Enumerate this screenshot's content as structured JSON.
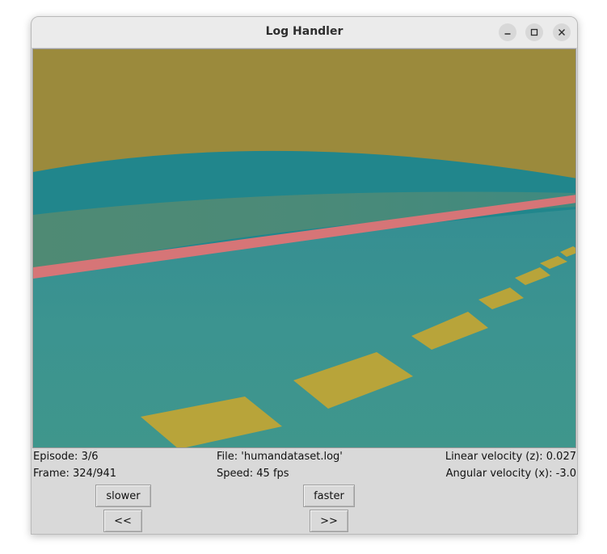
{
  "window": {
    "title": "Log Handler"
  },
  "status": {
    "episode": "Episode: 3/6",
    "frame": "Frame: 324/941",
    "file": "File: 'humandataset.log'",
    "speed": "Speed: 45 fps",
    "linear_velocity": "Linear velocity (z): 0.027",
    "angular_velocity": "Angular velocity (x): -3.0"
  },
  "controls": {
    "slower_label": "slower",
    "faster_label": "faster",
    "prev_label": "<<",
    "next_label": ">>"
  },
  "colors": {
    "sky": "#9b8a3c",
    "horizon": "#21868c",
    "road": "#3b9290",
    "grass": "#4b8a78",
    "edge_line": "#d67577",
    "lane_dash": "#b8a43a",
    "window_bg": "#d9d9d9"
  }
}
